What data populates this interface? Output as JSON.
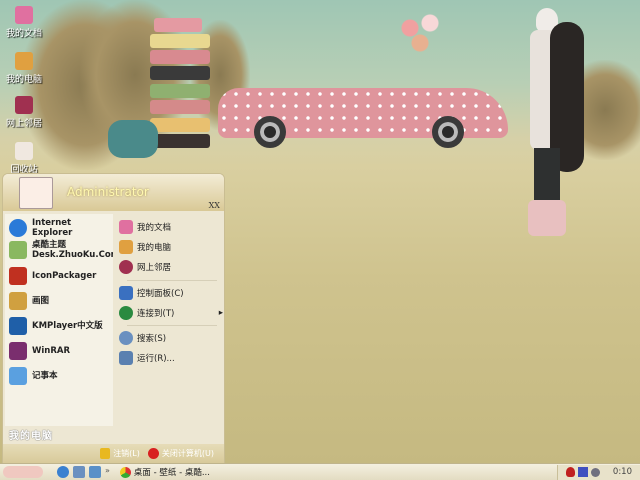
{
  "desktop": {
    "icons": [
      {
        "label": "我的文档",
        "icon": "my-documents-icon",
        "color": "#e070a0"
      },
      {
        "label": "我的电脑",
        "icon": "my-computer-icon",
        "color": "#e0a040"
      },
      {
        "label": "网上邻居",
        "icon": "network-icon",
        "color": "#a03050"
      },
      {
        "label": "回收站",
        "icon": "recycle-bin-icon",
        "color": "#f0e8e0"
      }
    ]
  },
  "start_menu": {
    "user": "Administrator",
    "corner": "XX",
    "pinned": [
      {
        "label": "Internet Explorer",
        "icon": "ie-icon",
        "color": "#2a7ad8"
      },
      {
        "label": "桌酷主题",
        "label2": "Desk.ZhuoKu.Com",
        "icon": "zhuoku-icon",
        "color": "#8ab860"
      },
      {
        "label": "IconPackager",
        "icon": "iconpackager-icon",
        "color": "#c03020"
      },
      {
        "label": "画图",
        "icon": "paint-icon",
        "color": "#d0a040"
      },
      {
        "label": "KMPlayer中文版",
        "icon": "kmplayer-icon",
        "color": "#1f5fa8"
      },
      {
        "label": "WinRAR",
        "icon": "winrar-icon",
        "color": "#7a2e6e"
      },
      {
        "label": "记事本",
        "icon": "notepad-icon",
        "color": "#5aa0e0"
      }
    ],
    "places": [
      {
        "label": "我的文档",
        "icon": "my-documents-icon",
        "color": "#e070a0"
      },
      {
        "label": "我的电脑",
        "icon": "my-computer-icon",
        "color": "#e0a040"
      },
      {
        "label": "网上邻居",
        "icon": "network-icon",
        "color": "#a03050"
      },
      {
        "label": "控制面板(C)",
        "icon": "control-panel-icon",
        "color": "#3a70c0"
      },
      {
        "label": "连接到(T)",
        "icon": "connect-icon",
        "color": "#2a8a40",
        "submenu": "▸"
      },
      {
        "label": "搜索(S)",
        "icon": "search-icon",
        "color": "#6a90c0"
      },
      {
        "label": "运行(R)...",
        "icon": "run-icon",
        "color": "#5a80b0"
      }
    ],
    "all_programs_deco": "我的电脑",
    "logoff": "注销(L)",
    "shutdown": "关闭计算机(U)"
  },
  "taskbar": {
    "quick_launch": [
      "ie-icon",
      "media-icon",
      "desktop-icon"
    ],
    "more": "»",
    "task": "桌面 - 壁纸 - 桌酷...",
    "tray_icons": [
      "qq-icon",
      "network-icon",
      "volume-icon"
    ],
    "clock": "0:10"
  }
}
